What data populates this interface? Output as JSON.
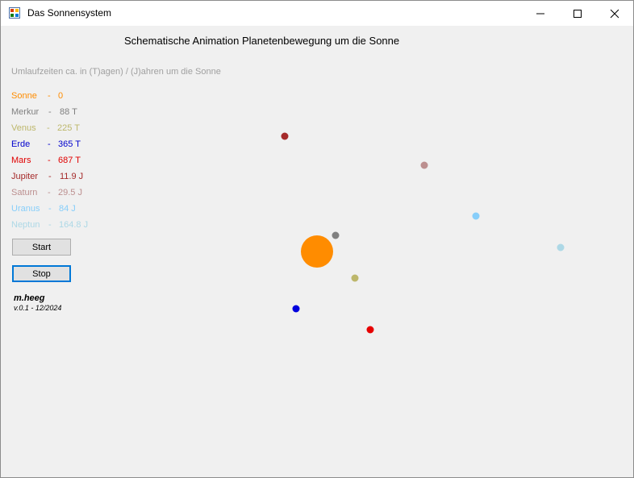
{
  "window": {
    "title": "Das Sonnensystem",
    "minimize_icon": "minimize-icon",
    "maximize_icon": "maximize-icon",
    "close_icon": "close-icon"
  },
  "main": {
    "heading": "Schematische Animation Planetenbewegung um die Sonne",
    "subheading": "Umlaufzeiten ca. in (T)agen) / (J)ahren um die Sonne",
    "subheading_color": "#a0a0a0",
    "legend": [
      {
        "name": "Sonne",
        "sep": "-",
        "period": "0",
        "color": "#ff8c00"
      },
      {
        "name": "Merkur",
        "sep": "-",
        "period": "88 T",
        "color": "#808080"
      },
      {
        "name": "Venus",
        "sep": "-",
        "period": "225 T",
        "color": "#bdb76b"
      },
      {
        "name": "Erde",
        "sep": "-",
        "period": "365 T",
        "color": "#0000cd"
      },
      {
        "name": "Mars",
        "sep": "-",
        "period": "687 T",
        "color": "#e00000"
      },
      {
        "name": "Jupiter",
        "sep": "-",
        "period": "11.9 J",
        "color": "#a52a2a"
      },
      {
        "name": "Saturn",
        "sep": "-",
        "period": "29.5 J",
        "color": "#bc8f8f"
      },
      {
        "name": "Uranus",
        "sep": "-",
        "period": "84 J",
        "color": "#87cefa"
      },
      {
        "name": "Neptun",
        "sep": "-",
        "period": "164.8 J",
        "color": "#add8e6"
      }
    ],
    "start_label": "Start",
    "stop_label": "Stop",
    "author": "m.heeg",
    "version": "v.0.1 - 12/2024"
  },
  "bodies": [
    {
      "name": "sun",
      "color": "#ff8c00"
    },
    {
      "name": "mercury",
      "color": "#808080"
    },
    {
      "name": "venus",
      "color": "#bdb76b"
    },
    {
      "name": "earth",
      "color": "#0000dd"
    },
    {
      "name": "mars",
      "color": "#e60000"
    },
    {
      "name": "jupiter",
      "color": "#a52a2a"
    },
    {
      "name": "saturn",
      "color": "#bc8f8f"
    },
    {
      "name": "uranus",
      "color": "#87cefa"
    },
    {
      "name": "neptune",
      "color": "#add8e6"
    }
  ]
}
